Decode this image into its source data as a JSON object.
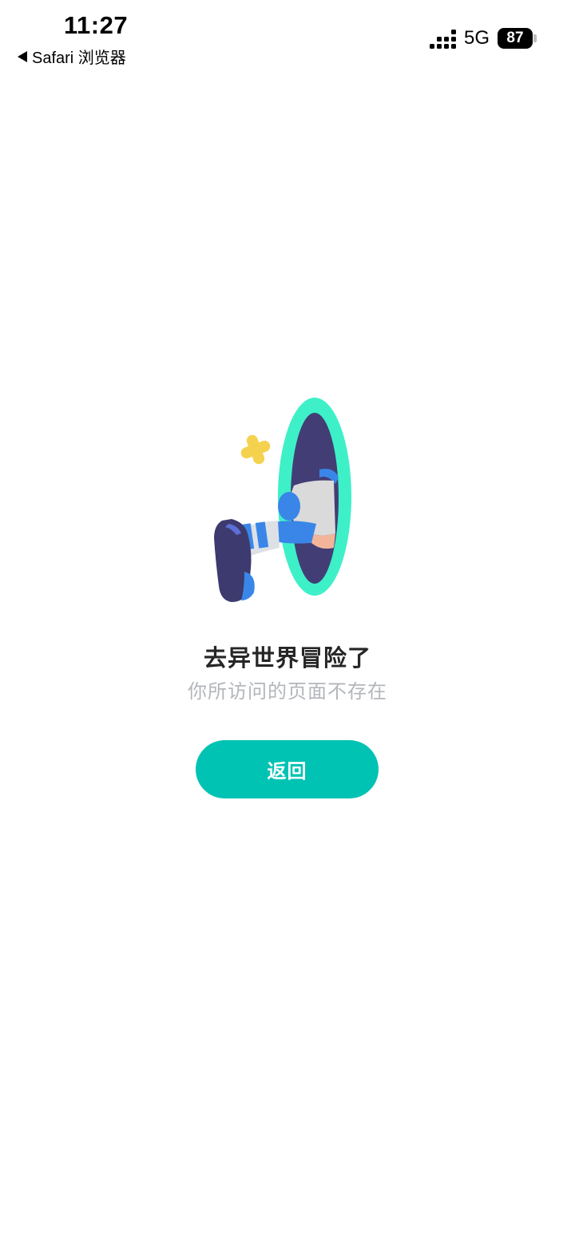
{
  "status_bar": {
    "time": "11:27",
    "back_app_label": "Safari 浏览器",
    "network": "5G",
    "battery": "87"
  },
  "error": {
    "title": "去异世界冒险了",
    "subtitle": "你所访问的页面不存在"
  },
  "actions": {
    "back_label": "返回"
  },
  "colors": {
    "accent": "#00c3b3",
    "portal_ring": "#3ef0c8",
    "portal_inside": "#423e75",
    "sparkle": "#f5d24e",
    "shoe_blue": "#3a86e8",
    "navy": "#3c3a6e",
    "subtitle_gray": "#b3b6bb"
  },
  "icons": {
    "signal": "signal-bars-icon",
    "battery": "battery-icon",
    "back": "back-arrow-icon",
    "illustration": "portal-illustration"
  }
}
